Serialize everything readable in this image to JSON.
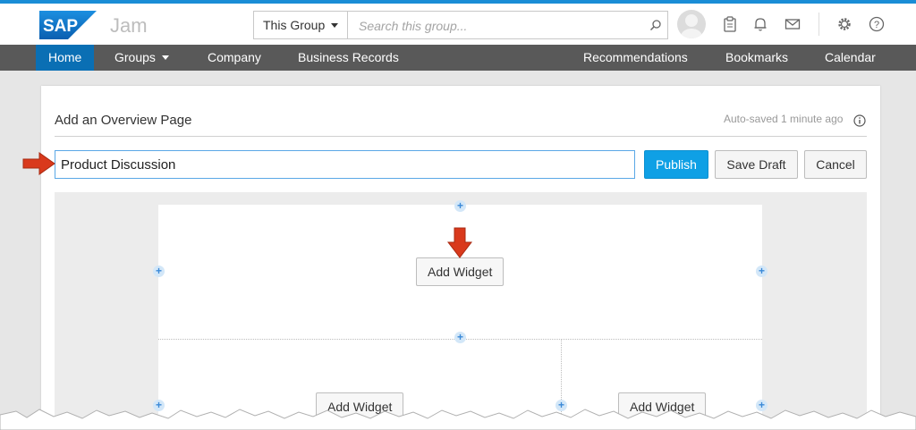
{
  "brand": {
    "logo_text": "SAP",
    "app_name": "Jam",
    "logo_color": "#0a6fb4"
  },
  "header": {
    "scope_label": "This Group",
    "search_placeholder": "Search this group...",
    "icons": [
      "avatar",
      "clipboard-icon",
      "bell-icon",
      "mail-icon",
      "gear-icon",
      "help-icon"
    ]
  },
  "nav": {
    "home": "Home",
    "groups": "Groups",
    "company": "Company",
    "business_records": "Business Records",
    "recommendations": "Recommendations",
    "bookmarks": "Bookmarks",
    "calendar": "Calendar"
  },
  "editor": {
    "page_title": "Add an Overview Page",
    "autosave_text": "Auto-saved 1 minute ago",
    "title_value": "Product Discussion",
    "publish_label": "Publish",
    "save_draft_label": "Save Draft",
    "cancel_label": "Cancel"
  },
  "layout": {
    "add_widget_label": "Add Widget",
    "add_widget_left_label": "Add Widget",
    "add_widget_right_label": "Add Widget",
    "plus_glyph": "+"
  },
  "colors": {
    "accent": "#0fa0e5",
    "nav_bg": "#595959",
    "nav_active": "#0a6fb4",
    "arrow": "#d9391c"
  }
}
